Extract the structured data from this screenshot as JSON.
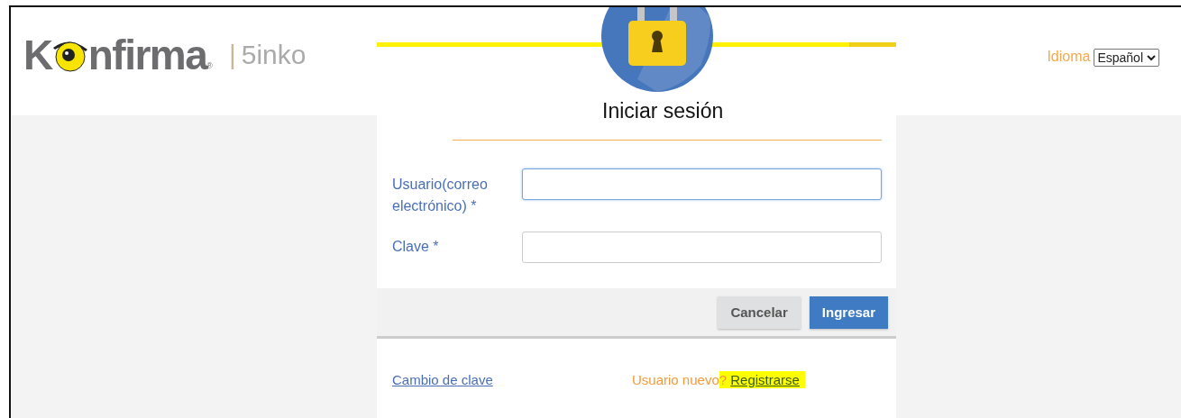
{
  "brand": {
    "logo_start": "K",
    "logo_end": "nfirma",
    "registered": "®",
    "separator": "|",
    "product": "5inko"
  },
  "language": {
    "label": "Idioma",
    "value": "Español"
  },
  "login": {
    "title": "Iniciar sesión",
    "fields": [
      {
        "label": "Usuario(correo electrónico) *",
        "focused": true
      },
      {
        "label": "Clave *",
        "focused": false
      }
    ],
    "buttons": [
      {
        "label": "Cancelar",
        "kind": "secondary"
      },
      {
        "label": "Ingresar",
        "kind": "primary"
      }
    ],
    "change_password": "Cambio de clave",
    "register": {
      "prompt": "Usuario nuevo",
      "mark": "?",
      "link": "Registrarse",
      "highlighted": true
    }
  }
}
